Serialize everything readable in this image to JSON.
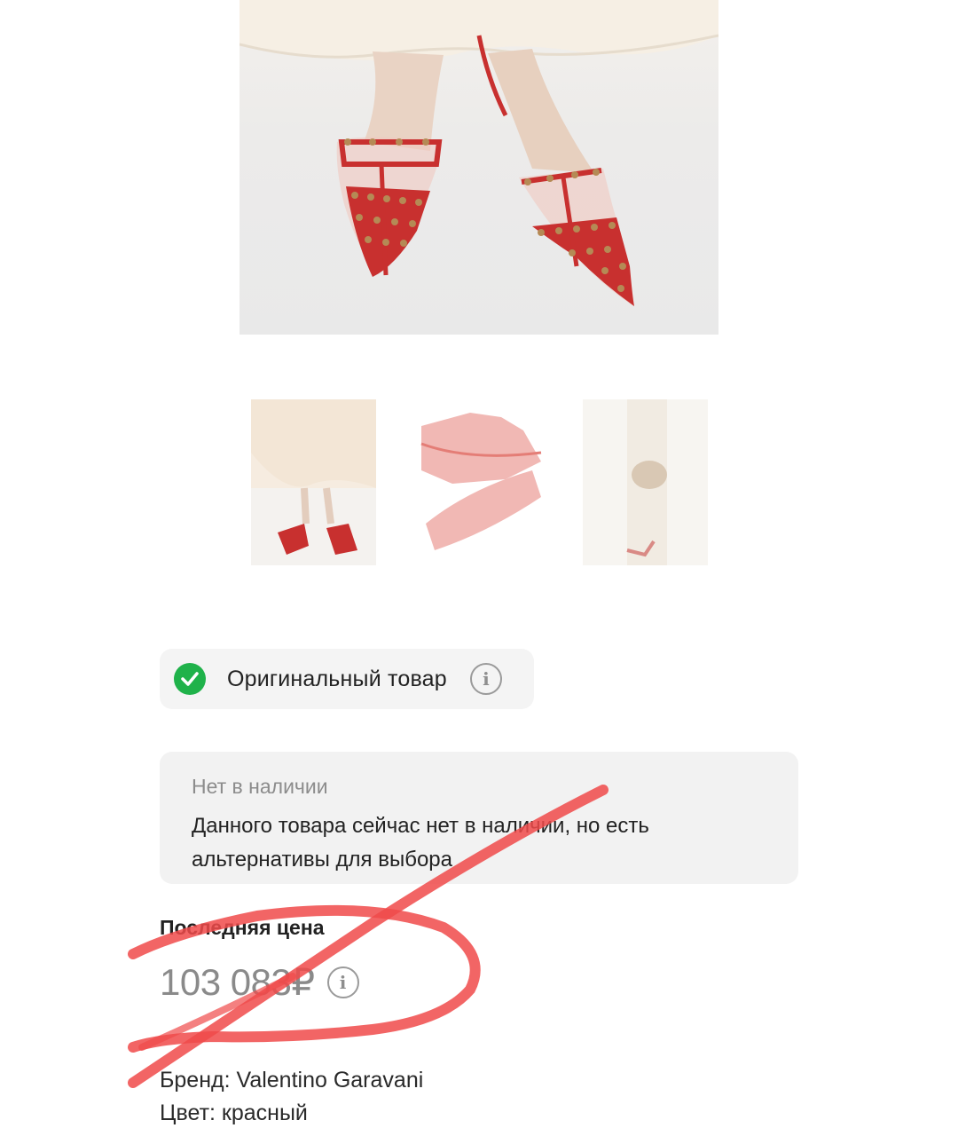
{
  "badge": {
    "label": "Оригинальный товар",
    "info_glyph": "i"
  },
  "stock": {
    "title": "Нет в наличии",
    "text": "Данного товара сейчас нет в наличии, но есть альтернативы для выбора"
  },
  "price": {
    "label": "Последняя цена",
    "value": "103 083₽",
    "info_glyph": "i"
  },
  "product": {
    "brand": "Бренд: Valentino Garavani",
    "color": "Цвет: красный"
  },
  "icons": {
    "check": "check-circle-icon",
    "info": "info-icon"
  },
  "colors": {
    "shoe_red": "#c8302f",
    "check_green": "#1fb24a",
    "annotation_red": "#f04a4a"
  }
}
